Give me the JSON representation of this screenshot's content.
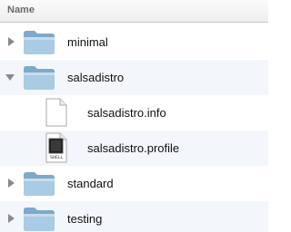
{
  "header": {
    "name_column": "Name"
  },
  "rows": [
    {
      "label": "minimal",
      "type": "folder",
      "state": "collapsed",
      "level": 0
    },
    {
      "label": "salsadistro",
      "type": "folder",
      "state": "expanded",
      "level": 0
    },
    {
      "label": "salsadistro.info",
      "type": "document",
      "level": 1
    },
    {
      "label": "salsadistro.profile",
      "type": "shell-script",
      "icon_caption": "SHELL",
      "level": 1
    },
    {
      "label": "standard",
      "type": "folder",
      "state": "collapsed",
      "level": 0
    },
    {
      "label": "testing",
      "type": "folder",
      "state": "collapsed",
      "level": 0
    }
  ]
}
